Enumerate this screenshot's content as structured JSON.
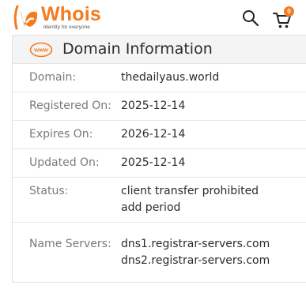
{
  "header": {
    "logo_text": "Whois",
    "logo_tagline": "Identity for everyone",
    "search_icon": "search-icon",
    "cart_icon": "cart-icon",
    "cart_count": "0",
    "brand_color": "#f47b20"
  },
  "panel": {
    "title": "Domain Information",
    "icon": "www-icon",
    "icon_text": "www",
    "rows": [
      {
        "label": "Domain:",
        "values": [
          "thedailyaus.world"
        ]
      },
      {
        "label": "Registered On:",
        "values": [
          "2025-12-14"
        ]
      },
      {
        "label": "Expires On:",
        "values": [
          "2026-12-14"
        ]
      },
      {
        "label": "Updated On:",
        "values": [
          "2025-12-14"
        ]
      },
      {
        "label": "Status:",
        "values": [
          "client transfer prohibited",
          "add period"
        ]
      },
      {
        "label": "Name Servers:",
        "values": [
          "dns1.registrar-servers.com",
          "dns2.registrar-servers.com"
        ]
      }
    ]
  }
}
